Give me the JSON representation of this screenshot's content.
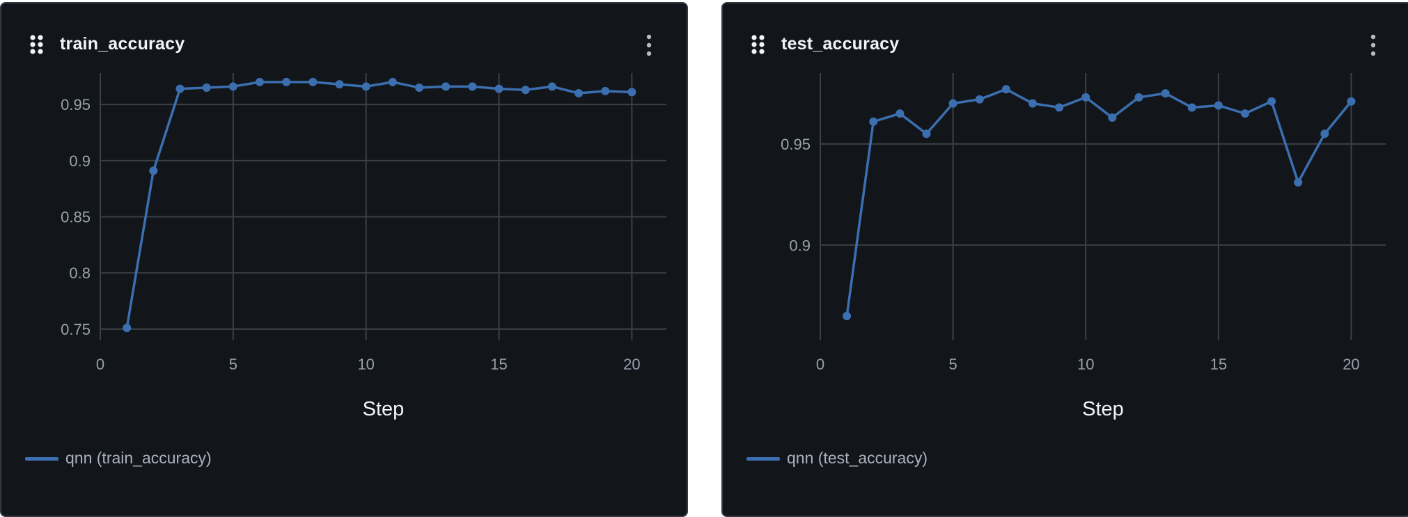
{
  "colors": {
    "series": "#3b6fb0",
    "grid": "#3b4047",
    "tick_text": "#98a1ad",
    "axis_title": "#f2f4f7"
  },
  "icons": {
    "drag": "drag-handle-icon",
    "menu": "more-vertical-icon"
  },
  "chart_data": [
    {
      "type": "line",
      "title": "train_accuracy",
      "xlabel": "Step",
      "ylabel": "",
      "xlim": [
        0,
        21.3
      ],
      "ylim": [
        0.74,
        0.978
      ],
      "xticks": [
        0,
        5,
        10,
        15,
        20
      ],
      "xtick_labels": [
        "0",
        "5",
        "10",
        "15",
        "20"
      ],
      "yticks": [
        0.75,
        0.8,
        0.85,
        0.9,
        0.95
      ],
      "ytick_labels": [
        "0.75",
        "0.8",
        "0.85",
        "0.9",
        "0.95"
      ],
      "grid": true,
      "legend": "bottom-left",
      "series": [
        {
          "name": "qnn (train_accuracy)",
          "x": [
            1,
            2,
            3,
            4,
            5,
            6,
            7,
            8,
            9,
            10,
            11,
            12,
            13,
            14,
            15,
            16,
            17,
            18,
            19,
            20
          ],
          "values": [
            0.751,
            0.891,
            0.964,
            0.965,
            0.966,
            0.97,
            0.97,
            0.97,
            0.968,
            0.966,
            0.97,
            0.965,
            0.966,
            0.966,
            0.964,
            0.963,
            0.966,
            0.96,
            0.962,
            0.961
          ]
        }
      ]
    },
    {
      "type": "line",
      "title": "test_accuracy",
      "xlabel": "Step",
      "ylabel": "",
      "xlim": [
        0,
        21.3
      ],
      "ylim": [
        0.853,
        0.985
      ],
      "xticks": [
        0,
        5,
        10,
        15,
        20
      ],
      "xtick_labels": [
        "0",
        "5",
        "10",
        "15",
        "20"
      ],
      "yticks": [
        0.9,
        0.95
      ],
      "ytick_labels": [
        "0.9",
        "0.95"
      ],
      "grid": true,
      "legend": "bottom-left",
      "series": [
        {
          "name": "qnn (test_accuracy)",
          "x": [
            1,
            2,
            3,
            4,
            5,
            6,
            7,
            8,
            9,
            10,
            11,
            12,
            13,
            14,
            15,
            16,
            17,
            18,
            19,
            20
          ],
          "values": [
            0.865,
            0.961,
            0.965,
            0.955,
            0.97,
            0.972,
            0.977,
            0.97,
            0.968,
            0.973,
            0.963,
            0.973,
            0.975,
            0.968,
            0.969,
            0.965,
            0.971,
            0.931,
            0.955,
            0.971
          ]
        }
      ]
    }
  ]
}
